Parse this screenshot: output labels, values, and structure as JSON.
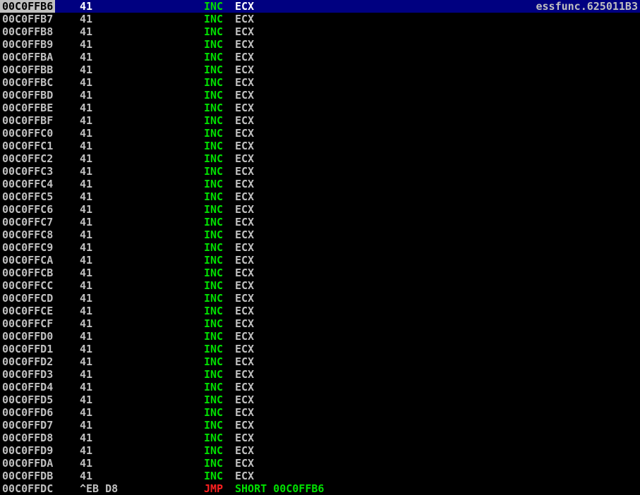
{
  "colors": {
    "background": "#000000",
    "selection_bg": "#000080",
    "address_text": "#c0c0c0",
    "inc_mnemonic": "#00e000",
    "jmp_mnemonic": "#ff2020",
    "jump_target": "#00e000"
  },
  "rows": [
    {
      "address": "00C0FFB6",
      "hex": "41",
      "mnemonic": "INC",
      "operand": "ECX",
      "comment": "essfunc.625011B3",
      "selected": true,
      "mnemonic_color": "green",
      "operand_color": "gray"
    },
    {
      "address": "00C0FFB7",
      "hex": "41",
      "mnemonic": "INC",
      "operand": "ECX",
      "comment": "",
      "selected": false,
      "mnemonic_color": "green",
      "operand_color": "gray"
    },
    {
      "address": "00C0FFB8",
      "hex": "41",
      "mnemonic": "INC",
      "operand": "ECX",
      "comment": "",
      "selected": false,
      "mnemonic_color": "green",
      "operand_color": "gray"
    },
    {
      "address": "00C0FFB9",
      "hex": "41",
      "mnemonic": "INC",
      "operand": "ECX",
      "comment": "",
      "selected": false,
      "mnemonic_color": "green",
      "operand_color": "gray"
    },
    {
      "address": "00C0FFBA",
      "hex": "41",
      "mnemonic": "INC",
      "operand": "ECX",
      "comment": "",
      "selected": false,
      "mnemonic_color": "green",
      "operand_color": "gray"
    },
    {
      "address": "00C0FFBB",
      "hex": "41",
      "mnemonic": "INC",
      "operand": "ECX",
      "comment": "",
      "selected": false,
      "mnemonic_color": "green",
      "operand_color": "gray"
    },
    {
      "address": "00C0FFBC",
      "hex": "41",
      "mnemonic": "INC",
      "operand": "ECX",
      "comment": "",
      "selected": false,
      "mnemonic_color": "green",
      "operand_color": "gray"
    },
    {
      "address": "00C0FFBD",
      "hex": "41",
      "mnemonic": "INC",
      "operand": "ECX",
      "comment": "",
      "selected": false,
      "mnemonic_color": "green",
      "operand_color": "gray"
    },
    {
      "address": "00C0FFBE",
      "hex": "41",
      "mnemonic": "INC",
      "operand": "ECX",
      "comment": "",
      "selected": false,
      "mnemonic_color": "green",
      "operand_color": "gray"
    },
    {
      "address": "00C0FFBF",
      "hex": "41",
      "mnemonic": "INC",
      "operand": "ECX",
      "comment": "",
      "selected": false,
      "mnemonic_color": "green",
      "operand_color": "gray"
    },
    {
      "address": "00C0FFC0",
      "hex": "41",
      "mnemonic": "INC",
      "operand": "ECX",
      "comment": "",
      "selected": false,
      "mnemonic_color": "green",
      "operand_color": "gray"
    },
    {
      "address": "00C0FFC1",
      "hex": "41",
      "mnemonic": "INC",
      "operand": "ECX",
      "comment": "",
      "selected": false,
      "mnemonic_color": "green",
      "operand_color": "gray"
    },
    {
      "address": "00C0FFC2",
      "hex": "41",
      "mnemonic": "INC",
      "operand": "ECX",
      "comment": "",
      "selected": false,
      "mnemonic_color": "green",
      "operand_color": "gray"
    },
    {
      "address": "00C0FFC3",
      "hex": "41",
      "mnemonic": "INC",
      "operand": "ECX",
      "comment": "",
      "selected": false,
      "mnemonic_color": "green",
      "operand_color": "gray"
    },
    {
      "address": "00C0FFC4",
      "hex": "41",
      "mnemonic": "INC",
      "operand": "ECX",
      "comment": "",
      "selected": false,
      "mnemonic_color": "green",
      "operand_color": "gray"
    },
    {
      "address": "00C0FFC5",
      "hex": "41",
      "mnemonic": "INC",
      "operand": "ECX",
      "comment": "",
      "selected": false,
      "mnemonic_color": "green",
      "operand_color": "gray"
    },
    {
      "address": "00C0FFC6",
      "hex": "41",
      "mnemonic": "INC",
      "operand": "ECX",
      "comment": "",
      "selected": false,
      "mnemonic_color": "green",
      "operand_color": "gray"
    },
    {
      "address": "00C0FFC7",
      "hex": "41",
      "mnemonic": "INC",
      "operand": "ECX",
      "comment": "",
      "selected": false,
      "mnemonic_color": "green",
      "operand_color": "gray"
    },
    {
      "address": "00C0FFC8",
      "hex": "41",
      "mnemonic": "INC",
      "operand": "ECX",
      "comment": "",
      "selected": false,
      "mnemonic_color": "green",
      "operand_color": "gray"
    },
    {
      "address": "00C0FFC9",
      "hex": "41",
      "mnemonic": "INC",
      "operand": "ECX",
      "comment": "",
      "selected": false,
      "mnemonic_color": "green",
      "operand_color": "gray"
    },
    {
      "address": "00C0FFCA",
      "hex": "41",
      "mnemonic": "INC",
      "operand": "ECX",
      "comment": "",
      "selected": false,
      "mnemonic_color": "green",
      "operand_color": "gray"
    },
    {
      "address": "00C0FFCB",
      "hex": "41",
      "mnemonic": "INC",
      "operand": "ECX",
      "comment": "",
      "selected": false,
      "mnemonic_color": "green",
      "operand_color": "gray"
    },
    {
      "address": "00C0FFCC",
      "hex": "41",
      "mnemonic": "INC",
      "operand": "ECX",
      "comment": "",
      "selected": false,
      "mnemonic_color": "green",
      "operand_color": "gray"
    },
    {
      "address": "00C0FFCD",
      "hex": "41",
      "mnemonic": "INC",
      "operand": "ECX",
      "comment": "",
      "selected": false,
      "mnemonic_color": "green",
      "operand_color": "gray"
    },
    {
      "address": "00C0FFCE",
      "hex": "41",
      "mnemonic": "INC",
      "operand": "ECX",
      "comment": "",
      "selected": false,
      "mnemonic_color": "green",
      "operand_color": "gray"
    },
    {
      "address": "00C0FFCF",
      "hex": "41",
      "mnemonic": "INC",
      "operand": "ECX",
      "comment": "",
      "selected": false,
      "mnemonic_color": "green",
      "operand_color": "gray"
    },
    {
      "address": "00C0FFD0",
      "hex": "41",
      "mnemonic": "INC",
      "operand": "ECX",
      "comment": "",
      "selected": false,
      "mnemonic_color": "green",
      "operand_color": "gray"
    },
    {
      "address": "00C0FFD1",
      "hex": "41",
      "mnemonic": "INC",
      "operand": "ECX",
      "comment": "",
      "selected": false,
      "mnemonic_color": "green",
      "operand_color": "gray"
    },
    {
      "address": "00C0FFD2",
      "hex": "41",
      "mnemonic": "INC",
      "operand": "ECX",
      "comment": "",
      "selected": false,
      "mnemonic_color": "green",
      "operand_color": "gray"
    },
    {
      "address": "00C0FFD3",
      "hex": "41",
      "mnemonic": "INC",
      "operand": "ECX",
      "comment": "",
      "selected": false,
      "mnemonic_color": "green",
      "operand_color": "gray"
    },
    {
      "address": "00C0FFD4",
      "hex": "41",
      "mnemonic": "INC",
      "operand": "ECX",
      "comment": "",
      "selected": false,
      "mnemonic_color": "green",
      "operand_color": "gray"
    },
    {
      "address": "00C0FFD5",
      "hex": "41",
      "mnemonic": "INC",
      "operand": "ECX",
      "comment": "",
      "selected": false,
      "mnemonic_color": "green",
      "operand_color": "gray"
    },
    {
      "address": "00C0FFD6",
      "hex": "41",
      "mnemonic": "INC",
      "operand": "ECX",
      "comment": "",
      "selected": false,
      "mnemonic_color": "green",
      "operand_color": "gray"
    },
    {
      "address": "00C0FFD7",
      "hex": "41",
      "mnemonic": "INC",
      "operand": "ECX",
      "comment": "",
      "selected": false,
      "mnemonic_color": "green",
      "operand_color": "gray"
    },
    {
      "address": "00C0FFD8",
      "hex": "41",
      "mnemonic": "INC",
      "operand": "ECX",
      "comment": "",
      "selected": false,
      "mnemonic_color": "green",
      "operand_color": "gray"
    },
    {
      "address": "00C0FFD9",
      "hex": "41",
      "mnemonic": "INC",
      "operand": "ECX",
      "comment": "",
      "selected": false,
      "mnemonic_color": "green",
      "operand_color": "gray"
    },
    {
      "address": "00C0FFDA",
      "hex": "41",
      "mnemonic": "INC",
      "operand": "ECX",
      "comment": "",
      "selected": false,
      "mnemonic_color": "green",
      "operand_color": "gray"
    },
    {
      "address": "00C0FFDB",
      "hex": "41",
      "mnemonic": "INC",
      "operand": "ECX",
      "comment": "",
      "selected": false,
      "mnemonic_color": "green",
      "operand_color": "gray"
    },
    {
      "address": "00C0FFDC",
      "hex": "^EB D8",
      "mnemonic": "JMP",
      "operand": "SHORT 00C0FFB6",
      "comment": "",
      "selected": false,
      "mnemonic_color": "red",
      "operand_color": "green"
    }
  ]
}
